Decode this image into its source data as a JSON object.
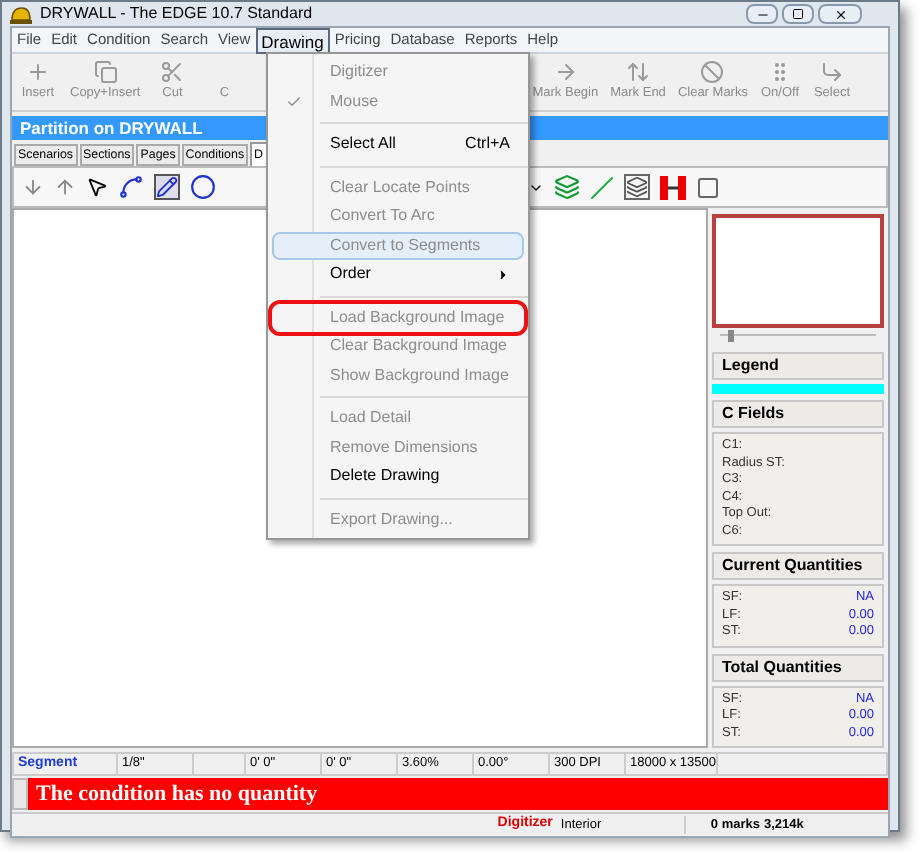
{
  "window": {
    "title": "DRYWALL - The EDGE 10.7 Standard"
  },
  "menu_bar": [
    {
      "label": "File",
      "selected": false
    },
    {
      "label": "Edit",
      "selected": false
    },
    {
      "label": "Condition",
      "selected": false
    },
    {
      "label": "Search",
      "selected": false
    },
    {
      "label": "View",
      "selected": false
    },
    {
      "label": "Drawing",
      "selected": true
    },
    {
      "label": "Pricing",
      "selected": false
    },
    {
      "label": "Database",
      "selected": false
    },
    {
      "label": "Reports",
      "selected": false
    },
    {
      "label": "Help",
      "selected": false
    }
  ],
  "toolbar_left": [
    "Insert",
    "Copy+Insert",
    "Cut",
    "C"
  ],
  "toolbar_right": [
    "Mark Begin",
    "Mark End",
    "Clear Marks",
    "On/Off",
    "Select"
  ],
  "header": "Partition on DRYWALL",
  "tabs": [
    {
      "label": "Scenarios",
      "selected": false
    },
    {
      "label": "Sections",
      "selected": false
    },
    {
      "label": "Pages",
      "selected": false
    },
    {
      "label": "Conditions",
      "selected": false
    },
    {
      "label": "D",
      "selected": true
    }
  ],
  "drawing_menu": [
    {
      "kind": "item",
      "label": "Digitizer",
      "disabled": true,
      "checked": false,
      "selected": false,
      "highlighted": false
    },
    {
      "kind": "item",
      "label": "Mouse",
      "disabled": true,
      "checked": true,
      "selected": false,
      "highlighted": false
    },
    {
      "kind": "separator"
    },
    {
      "kind": "item",
      "label": "Select All",
      "shortcut": "Ctrl+A",
      "disabled": false,
      "checked": false,
      "selected": false,
      "highlighted": false
    },
    {
      "kind": "separator"
    },
    {
      "kind": "item",
      "label": "Clear Locate Points",
      "disabled": true,
      "checked": false,
      "selected": false,
      "highlighted": false
    },
    {
      "kind": "item",
      "label": "Convert To Arc",
      "disabled": true,
      "checked": false,
      "selected": false,
      "highlighted": false
    },
    {
      "kind": "item",
      "label": "Convert to Segments",
      "disabled": true,
      "checked": false,
      "selected": true,
      "highlighted": false
    },
    {
      "kind": "item",
      "label": "Order",
      "submenu": true,
      "disabled": false,
      "checked": false,
      "selected": false,
      "highlighted": false
    },
    {
      "kind": "separator"
    },
    {
      "kind": "item",
      "label": "Load Background Image",
      "disabled": true,
      "checked": false,
      "selected": false,
      "highlighted": true
    },
    {
      "kind": "item",
      "label": "Clear Background Image",
      "disabled": true,
      "checked": false,
      "selected": false,
      "highlighted": false
    },
    {
      "kind": "item",
      "label": "Show Background Image",
      "disabled": true,
      "checked": false,
      "selected": false,
      "highlighted": false
    },
    {
      "kind": "separator"
    },
    {
      "kind": "item",
      "label": "Load Detail",
      "disabled": true,
      "checked": false,
      "selected": false,
      "highlighted": false
    },
    {
      "kind": "item",
      "label": "Remove Dimensions",
      "disabled": true,
      "checked": false,
      "selected": false,
      "highlighted": false
    },
    {
      "kind": "item",
      "label": "Delete Drawing",
      "disabled": false,
      "checked": false,
      "selected": false,
      "highlighted": false
    },
    {
      "kind": "separator"
    },
    {
      "kind": "item",
      "label": "Export Drawing...",
      "disabled": true,
      "checked": false,
      "selected": false,
      "highlighted": false
    }
  ],
  "side_panel": {
    "zoom_slider": {
      "level": 0.05
    },
    "legend": {
      "title": "Legend",
      "color": "#00ffff"
    },
    "c_fields": {
      "title": "C Fields",
      "fields": [
        "C1:",
        "Radius ST:",
        "C3:",
        "C4:",
        "Top Out:",
        "C6:"
      ]
    },
    "current_quantities": {
      "title": "Current Quantities",
      "rows": [
        {
          "label": "SF:",
          "value": "NA"
        },
        {
          "label": "LF:",
          "value": "0.00"
        },
        {
          "label": "ST:",
          "value": "0.00"
        }
      ]
    },
    "total_quantities": {
      "title": "Total Quantities",
      "rows": [
        {
          "label": "SF:",
          "value": "NA"
        },
        {
          "label": "LF:",
          "value": "0.00"
        },
        {
          "label": "ST:",
          "value": "0.00"
        }
      ]
    }
  },
  "status_row": [
    "Segment",
    "1/8\"",
    "0' 0\"",
    "0' 0\"",
    "3.60%",
    "0.00°",
    "300 DPI",
    "18000 x 13500"
  ],
  "message": "The condition has no quantity",
  "status_bar": {
    "mode": "Digitizer",
    "area": "Interior",
    "marks": "0 marks",
    "memory": "3,214k"
  }
}
